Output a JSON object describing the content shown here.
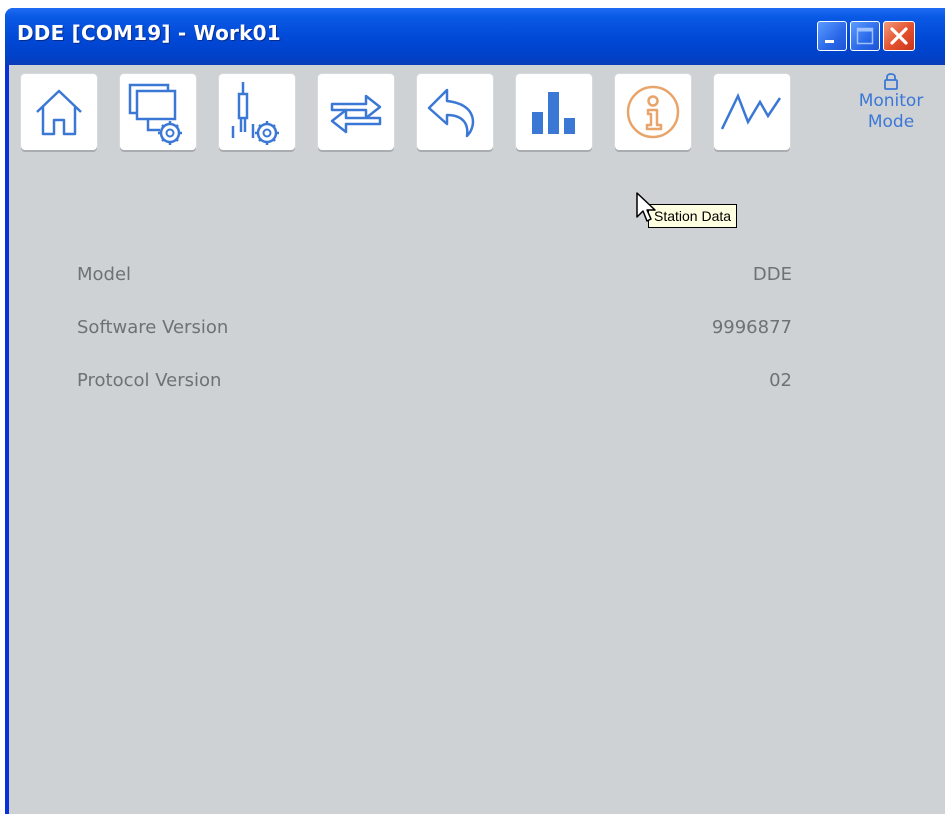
{
  "window": {
    "title": "DDE [COM19] - Work01",
    "accent": "#0048d6"
  },
  "toolbar": {
    "items": [
      {
        "name": "home-icon"
      },
      {
        "name": "station-settings-icon"
      },
      {
        "name": "tool-settings-icon"
      },
      {
        "name": "transfer-icon"
      },
      {
        "name": "back-icon"
      },
      {
        "name": "statistics-icon"
      },
      {
        "name": "station-data-icon",
        "state": "hovered"
      },
      {
        "name": "graph-icon"
      }
    ],
    "icon_color": "#3b78d6",
    "active_icon_color": "#e8a46a"
  },
  "monitor": {
    "line1": "Monitor",
    "line2": "Mode",
    "icon": "lock-icon"
  },
  "tooltip": {
    "text": "Station Data"
  },
  "station": {
    "rows": [
      {
        "label": "Model",
        "value": "DDE"
      },
      {
        "label": "Software Version",
        "value": "9996877"
      },
      {
        "label": "Protocol Version",
        "value": "02"
      }
    ]
  }
}
